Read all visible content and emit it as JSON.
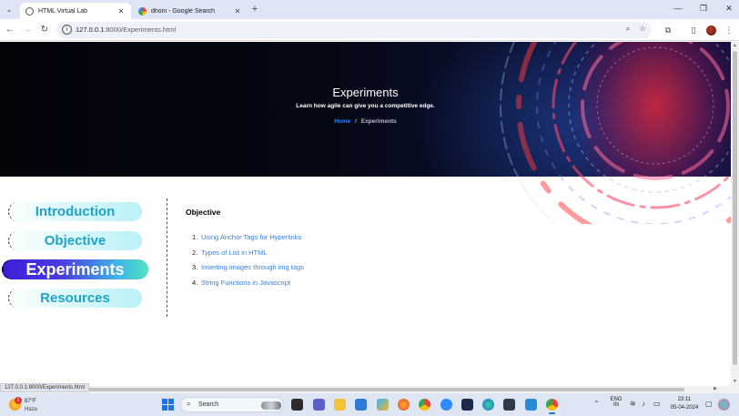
{
  "browser": {
    "tabs": [
      {
        "title": "HTML Virtual Lab",
        "active": true
      },
      {
        "title": "dhoni - Google Search",
        "active": false
      }
    ],
    "new_tab_icon": "plus-icon",
    "url_host": "127.0.0.1",
    "url_rest": ":8000/Experiments.html",
    "status_url": "127.0.0.1:8000/Experiments.html"
  },
  "hero": {
    "title": "Experiments",
    "subtitle": "Learn how agile can give you a competitive edge.",
    "breadcrumb": {
      "home": "Home",
      "separator": "/",
      "current": "Experiments"
    }
  },
  "sidebar": {
    "items": [
      {
        "label": "Introduction",
        "active": false
      },
      {
        "label": "Objective",
        "active": false
      },
      {
        "label": "Experiments",
        "active": true
      },
      {
        "label": "Resources",
        "active": false
      }
    ]
  },
  "content": {
    "heading": "Objective",
    "list": [
      {
        "num": "1.",
        "text": "Using Anchor Tags for Hyperlinks"
      },
      {
        "num": "2.",
        "text": "Types of List in HTML"
      },
      {
        "num": "3.",
        "text": "Inserting images through img tags"
      },
      {
        "num": "4.",
        "text": "String Functions in Javascript"
      }
    ]
  },
  "taskbar": {
    "weather": {
      "badge": "1",
      "temp": "87°F",
      "condition": "Haze"
    },
    "search_label": "Search",
    "language": {
      "lang": "ENG",
      "region": "IN"
    },
    "time": "23:11",
    "date": "05-04-2024"
  },
  "colors": {
    "accent_blue": "#3b7fd4",
    "divider_red": "#d62020",
    "pill_cyan": "#1fa3c8",
    "active_pill_start": "#3a1fd6"
  }
}
